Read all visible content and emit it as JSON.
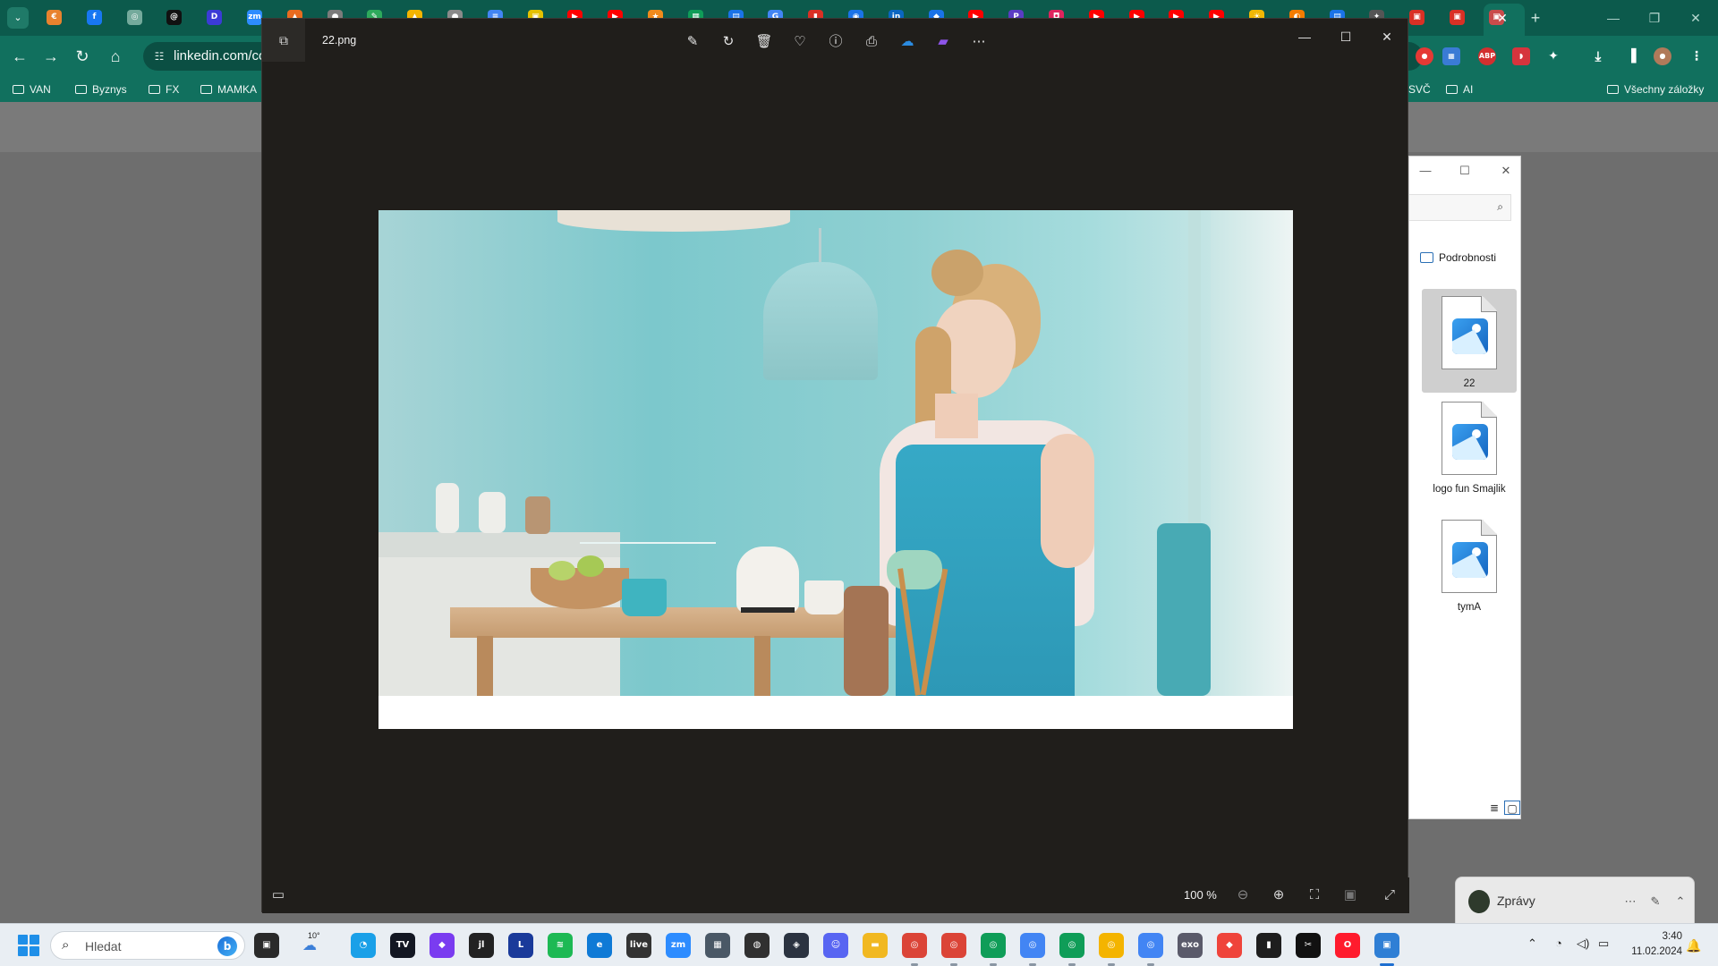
{
  "browser": {
    "url": "linkedin.com/co",
    "tab_favicons": [
      {
        "name": "favicon-orange-tab",
        "color": "#e8822e",
        "glyph": "€"
      },
      {
        "name": "favicon-facebook",
        "color": "#1877f2",
        "glyph": "f"
      },
      {
        "name": "favicon-chatgpt",
        "color": "#74aa9c",
        "glyph": "◎"
      },
      {
        "name": "favicon-threads",
        "color": "#111111",
        "glyph": "@"
      },
      {
        "name": "favicon-d",
        "color": "#3b3bd6",
        "glyph": "D"
      },
      {
        "name": "favicon-zoom",
        "color": "#2d8cff",
        "glyph": "zm"
      },
      {
        "name": "favicon-orange",
        "color": "#e96b1f",
        "glyph": "▲"
      },
      {
        "name": "favicon-grey",
        "color": "#7b7b7b",
        "glyph": "●"
      },
      {
        "name": "favicon-green",
        "color": "#2eaa5c",
        "glyph": "✎"
      },
      {
        "name": "favicon-drive",
        "color": "#f4b400",
        "glyph": "▲"
      },
      {
        "name": "favicon-grey2",
        "color": "#8a8a8a",
        "glyph": "●"
      },
      {
        "name": "favicon-docs",
        "color": "#4285f4",
        "glyph": "≡"
      },
      {
        "name": "favicon-yellow",
        "color": "#e5c100",
        "glyph": "▣"
      },
      {
        "name": "favicon-youtube",
        "color": "#ff0000",
        "glyph": "▶"
      },
      {
        "name": "favicon-youtube2",
        "color": "#ff0000",
        "glyph": "▶"
      },
      {
        "name": "favicon-orange2",
        "color": "#f08a1c",
        "glyph": "★"
      },
      {
        "name": "favicon-sheets",
        "color": "#0f9d58",
        "glyph": "▦"
      },
      {
        "name": "favicon-blue",
        "color": "#1a73e8",
        "glyph": "▤"
      },
      {
        "name": "favicon-google",
        "color": "#4285f4",
        "glyph": "G"
      },
      {
        "name": "favicon-pdf",
        "color": "#d93025",
        "glyph": "▮"
      },
      {
        "name": "favicon-blue2",
        "color": "#1a73e8",
        "glyph": "◉"
      },
      {
        "name": "favicon-linkedin",
        "color": "#0a66c2",
        "glyph": "in"
      },
      {
        "name": "favicon-maps",
        "color": "#1a73e8",
        "glyph": "◆"
      },
      {
        "name": "favicon-youtube3",
        "color": "#ff0000",
        "glyph": "▶"
      },
      {
        "name": "favicon-purple",
        "color": "#5b3cc4",
        "glyph": "P"
      },
      {
        "name": "favicon-pink",
        "color": "#e0245e",
        "glyph": "◘"
      },
      {
        "name": "favicon-youtube4",
        "color": "#ff0000",
        "glyph": "▶"
      },
      {
        "name": "favicon-youtube5",
        "color": "#ff0000",
        "glyph": "▶"
      },
      {
        "name": "favicon-youtube6",
        "color": "#ff0000",
        "glyph": "▶"
      },
      {
        "name": "favicon-youtube7",
        "color": "#ff0000",
        "glyph": "▶"
      },
      {
        "name": "favicon-yellow2",
        "color": "#f2b705",
        "glyph": "☀"
      },
      {
        "name": "favicon-orange3",
        "color": "#f57c00",
        "glyph": "◐"
      },
      {
        "name": "favicon-blue3",
        "color": "#1a73e8",
        "glyph": "▤"
      },
      {
        "name": "favicon-puzzle",
        "color": "#555555",
        "glyph": "✦"
      },
      {
        "name": "favicon-red",
        "color": "#d93025",
        "glyph": "▣"
      },
      {
        "name": "favicon-red2",
        "color": "#d93025",
        "glyph": "▣"
      }
    ],
    "active_tab_close": "✕",
    "new_tab": "+",
    "window_controls": {
      "minimize": "—",
      "restore": "❐",
      "close": "✕"
    },
    "bookmarks": [
      "VAN",
      "Byznys",
      "FX",
      "MAMKA",
      "SVČ",
      "AI"
    ],
    "all_bookmarks": "Všechny záložky"
  },
  "explorer": {
    "details": "Podrobnosti",
    "files": [
      "22",
      "logo fun Smajlik",
      "tymA"
    ],
    "selected_file": "22"
  },
  "viewer": {
    "filename": "22.png",
    "zoom": "100 %",
    "toolbar_icons": [
      "edit-icon",
      "rotate-icon",
      "delete-icon",
      "favorite-icon",
      "info-icon",
      "print-icon",
      "onedrive-icon",
      "clipchamp-icon",
      "more-icon"
    ]
  },
  "messages": {
    "label": "Zprávy"
  },
  "taskbar": {
    "search_placeholder": "Hledat",
    "weather": "10°",
    "time": "3:40",
    "date": "11.02.2024"
  }
}
